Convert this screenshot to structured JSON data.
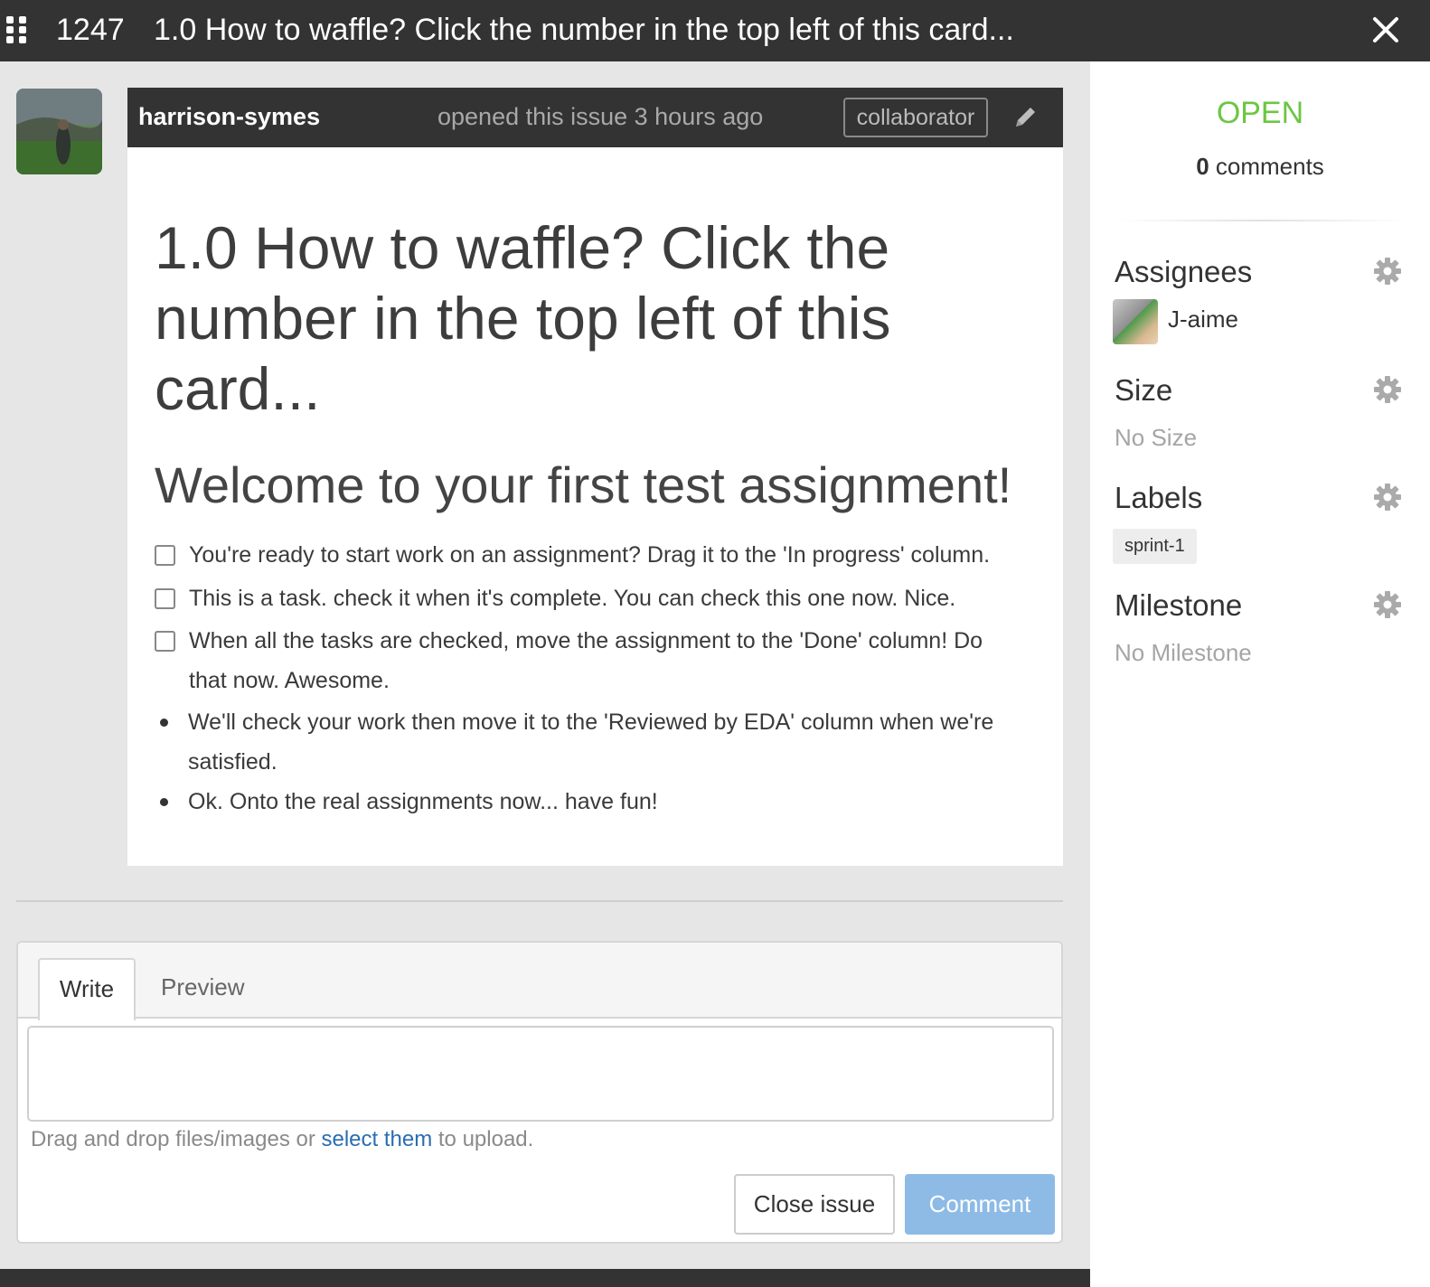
{
  "topbar": {
    "issue_number": "1247",
    "title": "1.0 How to waffle? Click the number in the top left of this card..."
  },
  "issue": {
    "author": "harrison-symes",
    "opened_text": "opened this issue 3 hours ago",
    "role_badge": "collaborator",
    "body_heading": "1.0 How to waffle? Click the number in the top left of this card...",
    "subheading": "Welcome to your first test assignment!",
    "tasks": [
      {
        "text": "You're ready to start work on an assignment? Drag it to the 'In progress' column.",
        "checked": false
      },
      {
        "text": "This is a task. check it when it's complete. You can check this one now. Nice.",
        "checked": false
      },
      {
        "text": "When all the tasks are checked, move the assignment to the 'Done' column! Do that now. Awesome.",
        "checked": false
      }
    ],
    "bullets": [
      "We'll check your work then move it to the 'Reviewed by EDA' column when we're satisfied.",
      "Ok. Onto the real assignments now... have fun!"
    ]
  },
  "comment_form": {
    "tabs": [
      "Write",
      "Preview"
    ],
    "active_tab": "Write",
    "textarea_value": "",
    "upload_hint_before": "Drag and drop files/images or ",
    "upload_hint_link": "select them",
    "upload_hint_after": " to upload.",
    "close_button": "Close issue",
    "comment_button": "Comment"
  },
  "sidebar": {
    "state": "OPEN",
    "comment_count": "0",
    "comment_label": "comments",
    "assignees_title": "Assignees",
    "assignees": [
      "J-aime"
    ],
    "size_title": "Size",
    "size_value": "No Size",
    "labels_title": "Labels",
    "labels": [
      "sprint-1"
    ],
    "milestone_title": "Milestone",
    "milestone_value": "No Milestone"
  },
  "colors": {
    "topbar": "#333333",
    "open_state": "#6cc644",
    "link": "#2a6db0",
    "comment_button": "#8dbbe6"
  },
  "icons": [
    "grip-icon",
    "close-icon",
    "pencil-icon",
    "gear-icon"
  ]
}
